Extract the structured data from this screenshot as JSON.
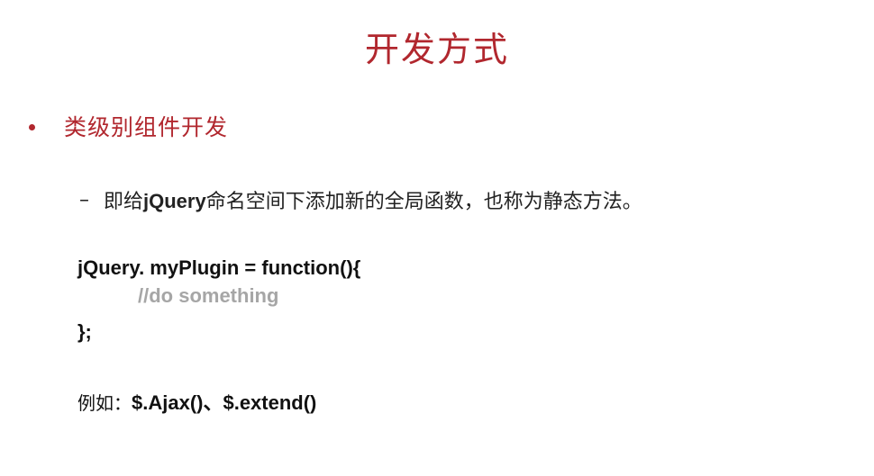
{
  "slide": {
    "title": "开发方式",
    "bullet": {
      "text": "类级别组件开发"
    },
    "sub_bullet": {
      "dash": "–",
      "prefix": "即给",
      "keyword": "jQuery",
      "suffix": "命名空间下添加新的全局函数，也称为静态方法。"
    },
    "code": {
      "line1": "jQuery. myPlugin = function(){",
      "comment": "//do something",
      "line3": "};"
    },
    "example": {
      "label": "例如：",
      "value": "$.Ajax()、$.extend()"
    }
  },
  "colors": {
    "accent": "#b1272e",
    "text": "#111111",
    "comment": "#a6a6a6",
    "background": "#ffffff"
  }
}
